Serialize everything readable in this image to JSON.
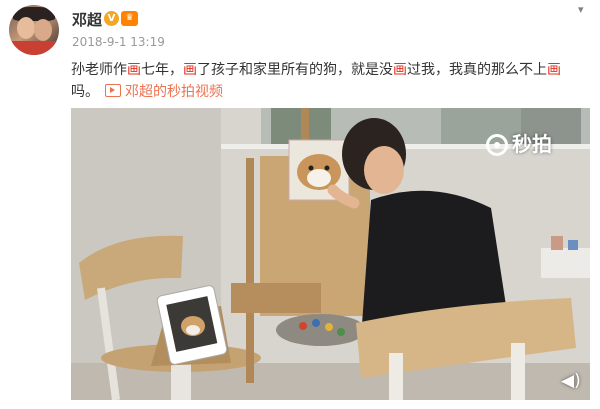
{
  "post": {
    "username": "邓超",
    "verified_badge": "V",
    "vip_icon": "vip-icon",
    "timestamp": "2018-9-1 13:19",
    "text": {
      "part1": "孙老师作",
      "hl1": "画",
      "part2": "七年，",
      "hl2": "画",
      "part3": "了孩子和家里所有的狗，就是没",
      "hl3": "画",
      "part4": "过我，我真的那么不上",
      "hl4": "画",
      "part5": "吗。"
    },
    "video_link_label": "邓超的秒拍视频"
  },
  "video": {
    "watermark": "秒拍",
    "volume_icon": "volume-icon"
  },
  "colors": {
    "highlight": "#e0301e",
    "link": "#eb7350",
    "timestamp": "#999999",
    "text": "#333333"
  }
}
